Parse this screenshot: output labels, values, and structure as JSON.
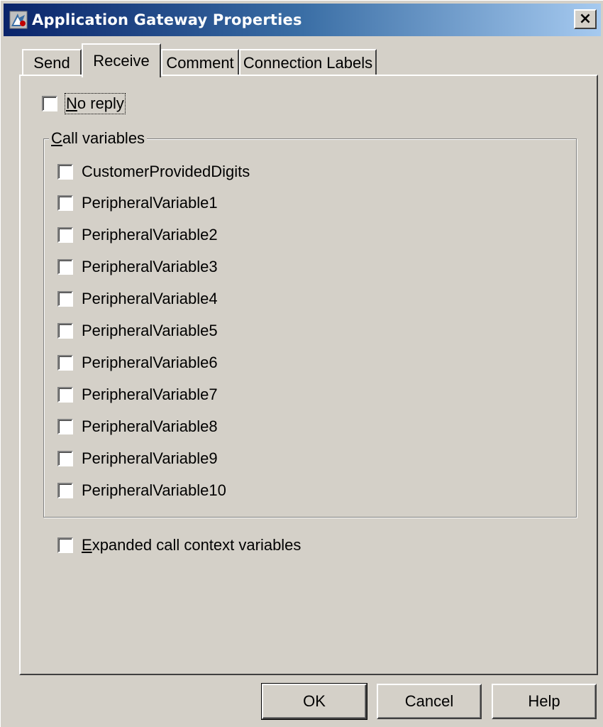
{
  "window": {
    "title": "Application Gateway Properties",
    "close_label": "×"
  },
  "tabs": [
    {
      "label": "Send",
      "active": false
    },
    {
      "label": "Receive",
      "active": true
    },
    {
      "label": "Comment",
      "active": false
    },
    {
      "label": "Connection Labels",
      "active": false
    }
  ],
  "receive": {
    "no_reply": {
      "label": "No reply",
      "checked": false
    },
    "call_variables": {
      "legend": "Call variables",
      "items": [
        {
          "label": "CustomerProvidedDigits",
          "checked": false
        },
        {
          "label": "PeripheralVariable1",
          "checked": false
        },
        {
          "label": "PeripheralVariable2",
          "checked": false
        },
        {
          "label": "PeripheralVariable3",
          "checked": false
        },
        {
          "label": "PeripheralVariable4",
          "checked": false
        },
        {
          "label": "PeripheralVariable5",
          "checked": false
        },
        {
          "label": "PeripheralVariable6",
          "checked": false
        },
        {
          "label": "PeripheralVariable7",
          "checked": false
        },
        {
          "label": "PeripheralVariable8",
          "checked": false
        },
        {
          "label": "PeripheralVariable9",
          "checked": false
        },
        {
          "label": "PeripheralVariable10",
          "checked": false
        }
      ]
    },
    "expanded": {
      "label": "Expanded call context variables",
      "checked": false
    }
  },
  "buttons": {
    "ok": "OK",
    "cancel": "Cancel",
    "help": "Help"
  },
  "colors": {
    "titlebar_start": "#0a246a",
    "titlebar_end": "#a6caf0",
    "face": "#d4d0c8"
  }
}
